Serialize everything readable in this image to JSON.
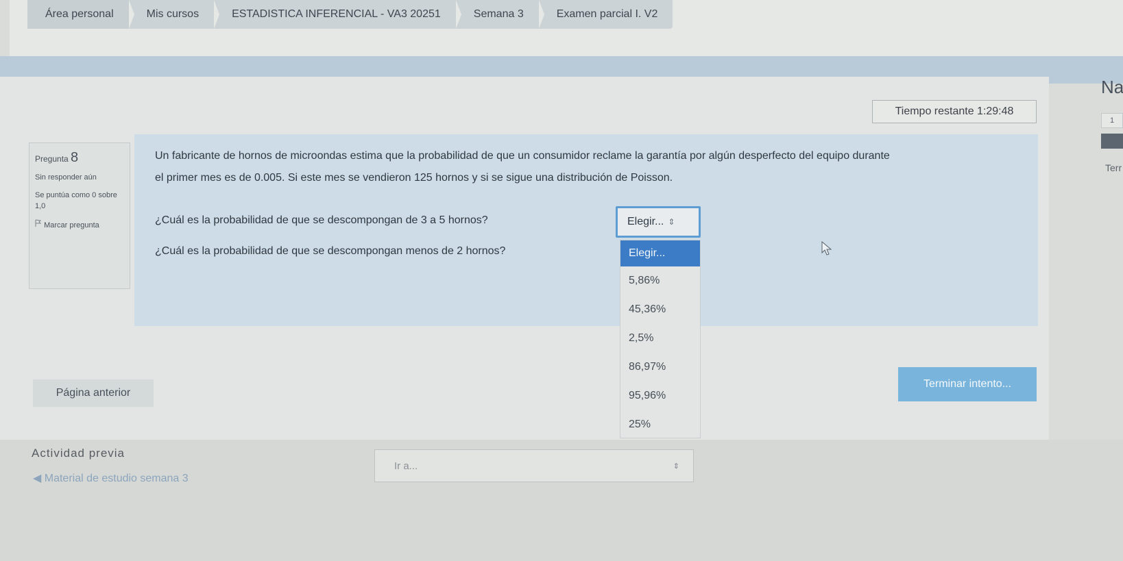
{
  "breadcrumb": [
    "Área personal",
    "Mis cursos",
    "ESTADISTICA INFERENCIAL - VA3 20251",
    "Semana 3",
    "Examen parcial I. V2"
  ],
  "timer": "Tiempo restante 1:29:48",
  "question_info": {
    "label": "Pregunta",
    "number": "8",
    "status": "Sin responder aún",
    "score": "Se puntúa como 0 sobre 1,0",
    "flag": "Marcar pregunta"
  },
  "question": {
    "text": "Un fabricante de hornos de microondas estima que la probabilidad de que un consumidor reclame la garantía por algún desperfecto del equipo durante el primer mes es de 0.005. Si este mes se vendieron 125 hornos y si se sigue  una distribución de Poisson.",
    "sub_questions": [
      {
        "text": "¿Cuál es la probabilidad de que se descompongan de 3 a 5 hornos?",
        "selected": "Elegir..."
      },
      {
        "text": "¿Cuál es la probabilidad de que se descompongan menos de 2 hornos?",
        "selected": "Elegir..."
      }
    ],
    "dropdown_options": [
      "5,86%",
      "45,36%",
      "2,5%",
      "86,97%",
      "95,96%",
      "25%"
    ]
  },
  "buttons": {
    "prev_page": "Página anterior",
    "finish": "Terminar intento..."
  },
  "footer": {
    "prev_activity_title": "Actividad previa",
    "prev_activity_link": "◀ Material de estudio semana 3",
    "jump_placeholder": "Ir a..."
  },
  "nav": {
    "title": "Na",
    "cell": "1",
    "term": "Terr"
  },
  "colors": {
    "accent": "#3c7cc6",
    "finish_button": "#78b4dc",
    "select_border": "#5e9cd4"
  },
  "icons": {
    "select_arrow": "updown-arrow-icon",
    "flag": "flag-icon",
    "cursor": "mouse-pointer-icon"
  }
}
